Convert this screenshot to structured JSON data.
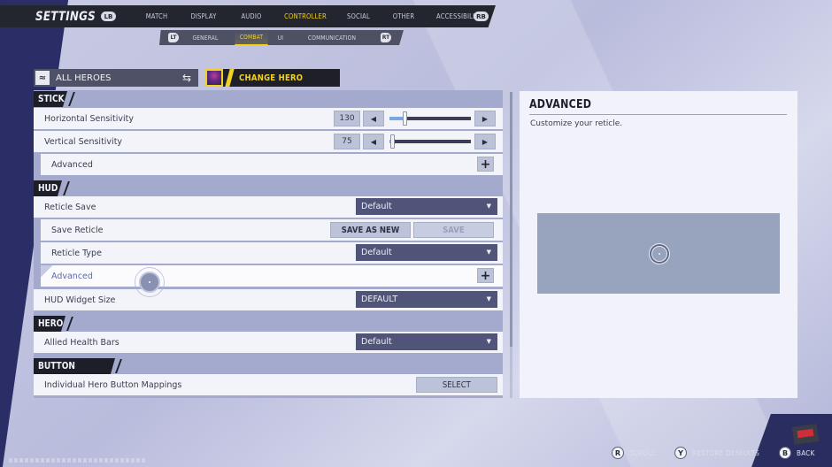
{
  "header": {
    "title": "SETTINGS",
    "left_bumper": "LB",
    "right_bumper": "RB",
    "tabs": [
      {
        "label": "MATCH",
        "active": false
      },
      {
        "label": "DISPLAY",
        "active": false
      },
      {
        "label": "AUDIO",
        "active": false
      },
      {
        "label": "CONTROLLER",
        "active": true
      },
      {
        "label": "SOCIAL",
        "active": false
      },
      {
        "label": "OTHER",
        "active": false
      },
      {
        "label": "ACCESSIBILITY",
        "active": false
      }
    ],
    "subtabs": {
      "left_trigger": "LT",
      "right_trigger": "RT",
      "items": [
        {
          "label": "GENERAL",
          "active": false
        },
        {
          "label": "COMBAT",
          "active": true
        },
        {
          "label": "UI",
          "active": false
        },
        {
          "label": "COMMUNICATION",
          "active": false
        }
      ]
    }
  },
  "hero_bar": {
    "selected": "ALL HEROES",
    "swap_icon": "swap-arrows-icon",
    "change_hero_label": "CHANGE HERO"
  },
  "sections": {
    "stick": {
      "title": "STICK",
      "horizontal": {
        "label": "Horizontal Sensitivity",
        "value": "130",
        "fraction": 0.18
      },
      "vertical": {
        "label": "Vertical Sensitivity",
        "value": "75",
        "fraction": 0.03
      },
      "advanced": {
        "label": "Advanced"
      }
    },
    "hud": {
      "title": "HUD",
      "reticle_save": {
        "label": "Reticle Save",
        "value": "Default"
      },
      "save_reticle": {
        "label": "Save Reticle",
        "save_as_new": "SAVE AS NEW",
        "save": "SAVE"
      },
      "reticle_type": {
        "label": "Reticle Type",
        "value": "Default"
      },
      "advanced": {
        "label": "Advanced"
      },
      "hud_widget_size": {
        "label": "HUD Widget Size",
        "value": "DEFAULT"
      }
    },
    "hero": {
      "title": "HERO",
      "allied_health_bars": {
        "label": "Allied Health Bars",
        "value": "Default"
      }
    },
    "button_mapping": {
      "title": "BUTTON MAPPING",
      "individual": {
        "label": "Individual Hero Button Mappings",
        "button": "SELECT"
      }
    }
  },
  "info_panel": {
    "title": "ADVANCED",
    "description": "Customize your reticle."
  },
  "footer": {
    "scroll": {
      "button": "R",
      "label": "SCROLL"
    },
    "restore": {
      "button": "Y",
      "label": "RESTORE DEFAULTS"
    },
    "back": {
      "button": "B",
      "label": "BACK"
    }
  },
  "colors": {
    "accent": "#f1d220",
    "nav_bg": "#24262f",
    "dropdown_bg": "#4f5478",
    "panel_bg": "#a4aacd",
    "row_bg": "#f3f4fa",
    "slider_fill": "#7aa6e0"
  }
}
